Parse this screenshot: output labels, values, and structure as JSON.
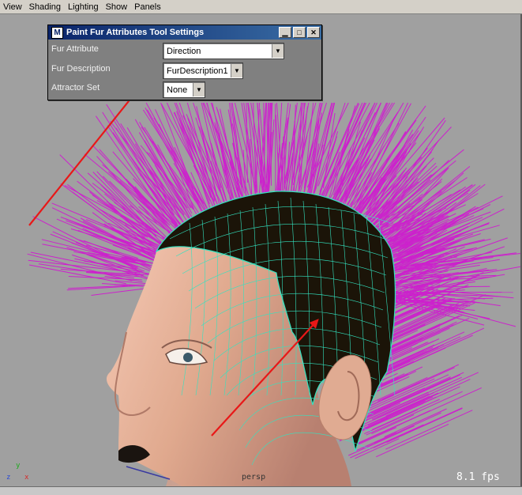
{
  "menu": [
    "View",
    "Shading",
    "Lighting",
    "Show",
    "Panels"
  ],
  "tool_window": {
    "title": "Paint Fur Attributes Tool Settings",
    "logo": "M",
    "rows": [
      {
        "label": "Fur Attribute",
        "value": "Direction"
      },
      {
        "label": "Fur Description",
        "value": "FurDescription1"
      },
      {
        "label": "Attractor Set",
        "value": "None"
      }
    ]
  },
  "viewport": {
    "camera_label": "persp",
    "fps": "8.1 fps",
    "axis": {
      "y": "y",
      "z": "z",
      "x": "x"
    },
    "fur_color": "#cc22cc",
    "wire_color": "#33e3c0",
    "arrow_color": "#e81818",
    "background": "#a0a0a0"
  }
}
